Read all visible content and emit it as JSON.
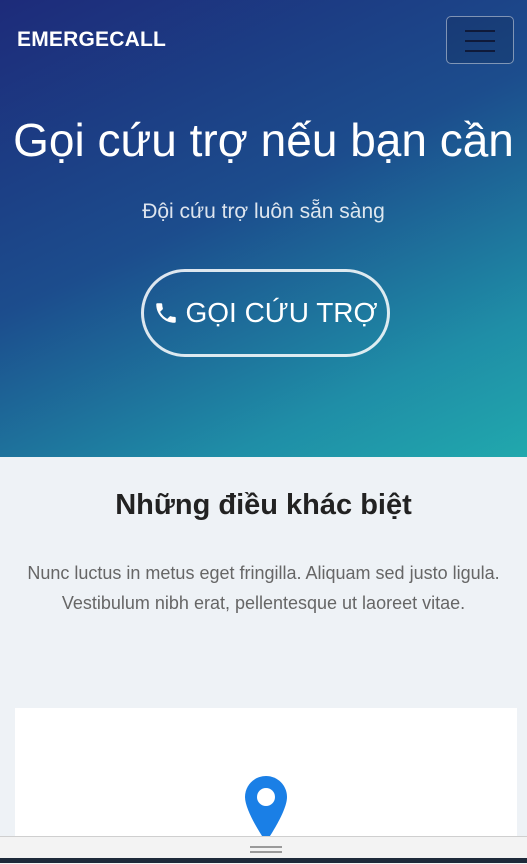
{
  "navbar": {
    "brand": "EMERGECALL",
    "menu_icon": "hamburger-icon"
  },
  "hero": {
    "title": "Gọi cứu trợ nếu bạn cần",
    "subtitle": "Đội cứu trợ luôn sẵn sàng",
    "cta_label": "GỌI CỨU TRỢ",
    "cta_icon": "phone-icon"
  },
  "features": {
    "title": "Những điều khác biệt",
    "description": "Nunc luctus in metus eget fringilla. Aliquam sed justo ligula. Vestibulum nibh erat, pellentesque ut laoreet vitae.",
    "card_icon": "map-pin-icon"
  },
  "colors": {
    "gradient_start": "#1d2b7a",
    "gradient_end": "#21a8ad",
    "pin": "#1a7fe6",
    "section_bg": "#eef2f6"
  }
}
